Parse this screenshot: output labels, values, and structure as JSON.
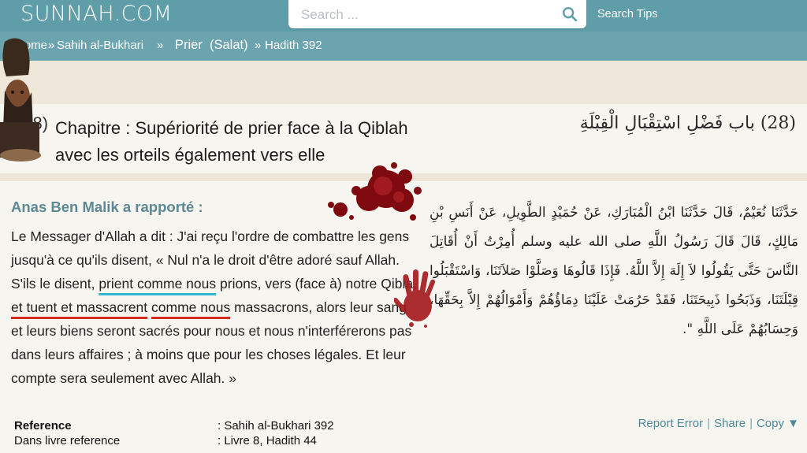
{
  "header": {
    "logo": "SUNNAH.COM",
    "search_placeholder": "Search ...",
    "search_tips": "Search Tips"
  },
  "breadcrumb": {
    "home": "Home",
    "sep1": "»",
    "collection": "Sahih al-Bukhari",
    "sep2": "»",
    "book": "Prier  (Salat)",
    "sep3": "»",
    "hadith": "Hadith 392"
  },
  "chapter": {
    "number_left": "(28)",
    "title_fr_line1": "Chapitre : Supériorité de prier face à la Qiblah",
    "title_fr_line2": "avec les orteils également vers elle",
    "title_ar": "(28) باب فَضْلِ اسْتِقْبَالِ الْقِبْلَةِ"
  },
  "hadith": {
    "narrator": "Anas Ben Malik a rapporté :",
    "text_fr": {
      "part1": "Le Messager d'Allah a dit : J'ai reçu l'ordre de combattre les gens jusqu'à ce qu'ils disent, « Nul n'a le droit d'être adoré sauf Allah. S'ils le disent, ",
      "highlight1": "prient comme nous",
      "part2": " prions, vers (face à) notre Qibla, ",
      "highlight2a": "et tuent et massacrent",
      "part3": " ",
      "highlight2b": "comme nous",
      "part4": " massacrons, alors leur sang et leurs biens seront sacrés pour nous et nous n'interférerons pas dans leurs affaires ; à moins que pour les choses légales. Et leur compte sera seulement avec Allah. »"
    },
    "text_ar": "حَدَّثَنَا نُعَيْمٌ، قَالَ حَدَّثَنَا ابْنُ الْمُبَارَكِ، عَنْ حُمَيْدٍ الطَّوِيلِ، عَنْ أَنَسِ بْنِ مَالِكٍ، قَالَ قَالَ رَسُولُ اللَّهِ صلى الله عليه وسلم أُمِرْتُ أَنْ أُقَاتِلَ النَّاسَ حَتَّى يَقُولُوا لاَ إِلَهَ إِلاَّ اللَّهُ‏.‏ فَإِذَا قَالُوهَا وَصَلَّوْا صَلاَتَنَا، وَاسْتَقْبَلُوا قِبْلَتَنَا، وَذَبَحُوا ذَبِيحَتَنَا، فَقَدْ حَرُمَتْ عَلَيْنَا دِمَاؤُهُمْ وَأَمْوَالُهُمْ إِلاَّ بِحَقِّهَا، وَحِسَابُهُمْ عَلَى اللَّهِ ‏\"‏‏.‏",
    "reference": {
      "label": "Reference",
      "value": ": Sahih al-Bukhari 392",
      "book_label": "Dans livre reference",
      "book_value": ": Livre 8, Hadith 44"
    },
    "actions": {
      "report": "Report Error",
      "sep": "|",
      "share": "Share",
      "copy": "Copy ▼"
    }
  },
  "colors": {
    "header": "#5f9ea9",
    "breadcrumb": "#6ba4ae",
    "narrator": "#5c8993",
    "underline_cyan": "#2fb8cf",
    "underline_red": "#d42a20"
  }
}
